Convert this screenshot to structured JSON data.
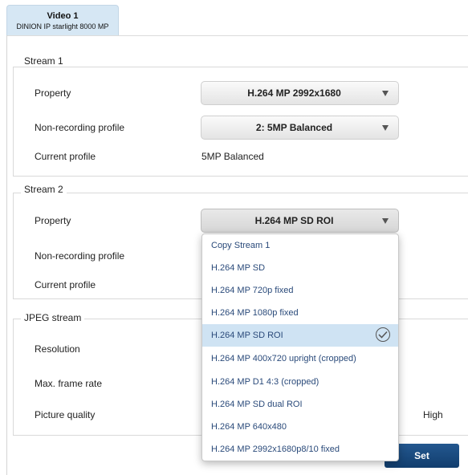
{
  "tab": {
    "title": "Video 1",
    "subtitle": "DINION IP starlight 8000 MP"
  },
  "stream1": {
    "title": "Stream 1",
    "property_label": "Property",
    "property_value": "H.264 MP 2992x1680",
    "nonrec_label": "Non-recording profile",
    "nonrec_value": "2: 5MP Balanced",
    "current_label": "Current profile",
    "current_value": "5MP Balanced"
  },
  "stream2": {
    "title": "Stream 2",
    "property_label": "Property",
    "property_value": "H.264 MP SD ROI",
    "nonrec_label": "Non-recording profile",
    "current_label": "Current profile"
  },
  "jpeg": {
    "title": "JPEG stream",
    "resolution_label": "Resolution",
    "framerate_label": "Max. frame rate",
    "quality_label": "Picture quality",
    "quality_value": "High"
  },
  "dropdown": {
    "selected_index": 4,
    "options": [
      "Copy Stream 1",
      "H.264 MP SD",
      "H.264 MP 720p fixed",
      "H.264 MP 1080p fixed",
      "H.264 MP SD ROI",
      "H.264 MP 400x720 upright (cropped)",
      "H.264 MP D1 4:3 (cropped)",
      "H.264 MP SD dual ROI",
      "H.264 MP 640x480",
      "H.264 MP 2992x1680p8/10 fixed"
    ]
  },
  "set_label": "Set",
  "icons": {
    "arrow": "chevron-down-icon",
    "check": "check-circle-icon"
  }
}
